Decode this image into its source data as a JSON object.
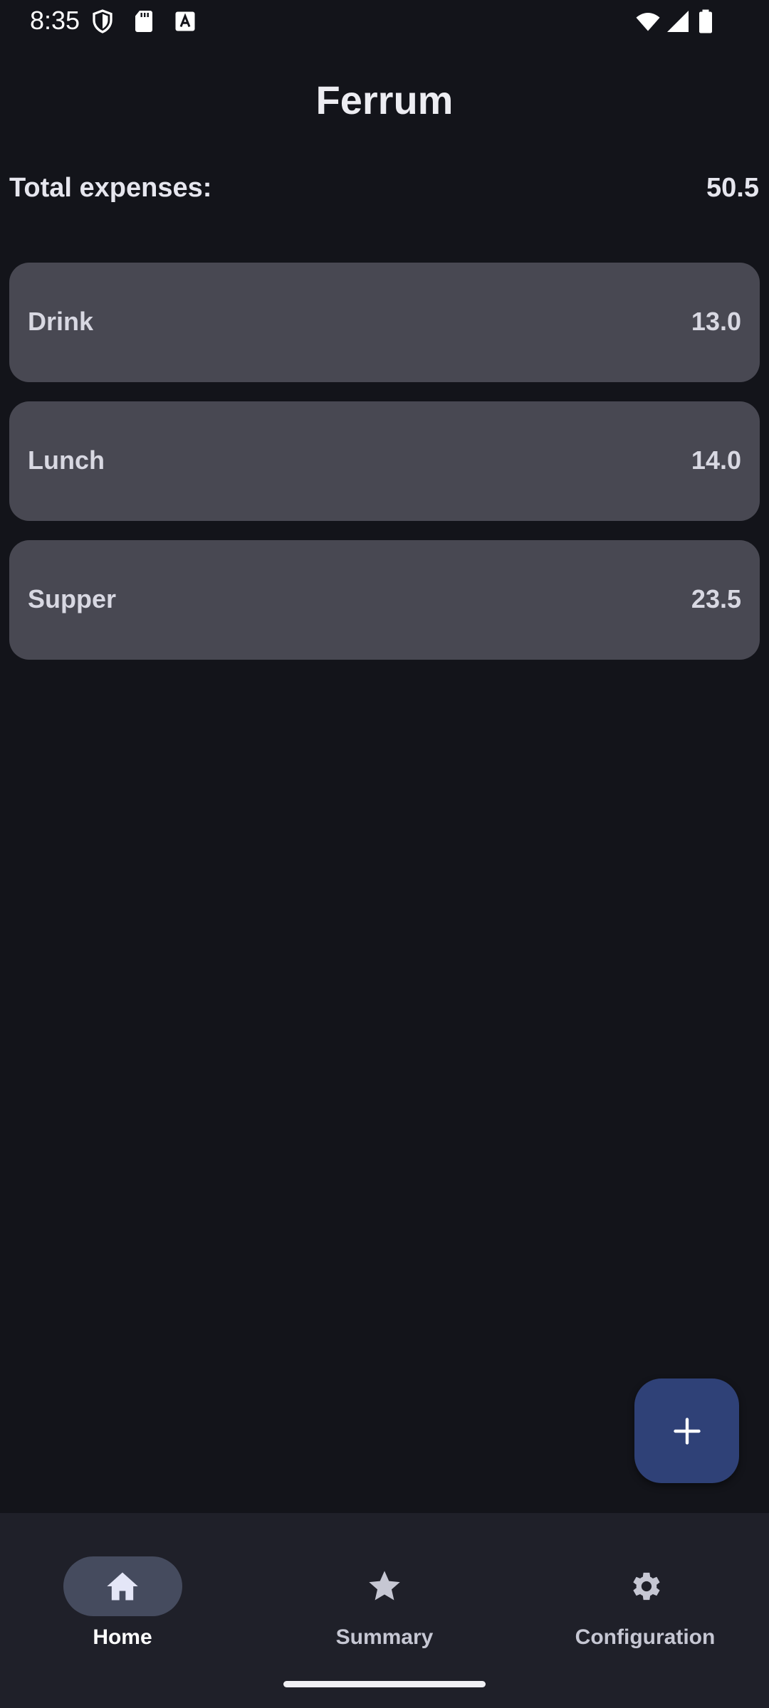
{
  "status_bar": {
    "time": "8:35"
  },
  "app": {
    "title": "Ferrum"
  },
  "total": {
    "label": "Total expenses:",
    "value": "50.5"
  },
  "expenses": [
    {
      "name": "Drink",
      "amount": "13.0"
    },
    {
      "name": "Lunch",
      "amount": "14.0"
    },
    {
      "name": "Supper",
      "amount": "23.5"
    }
  ],
  "fab": {
    "icon": "plus-icon"
  },
  "bottom_nav": {
    "items": [
      {
        "label": "Home",
        "icon": "home-icon",
        "active": true
      },
      {
        "label": "Summary",
        "icon": "star-icon",
        "active": false
      },
      {
        "label": "Configuration",
        "icon": "gear-icon",
        "active": false
      }
    ]
  },
  "colors": {
    "background": "#13141a",
    "card": "#484852",
    "fab": "#2f4177",
    "nav_background": "#1f2029",
    "nav_indicator": "#454b5e"
  }
}
